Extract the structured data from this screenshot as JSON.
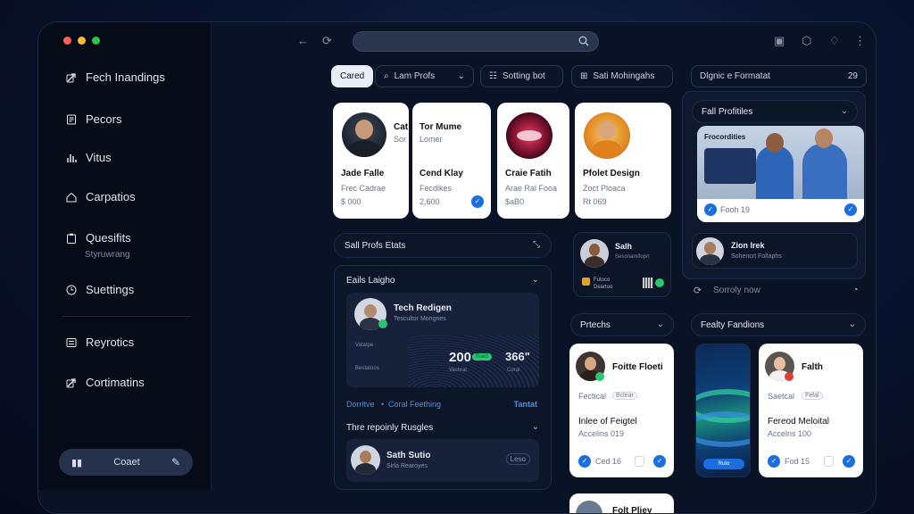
{
  "sidebar": {
    "items": [
      {
        "label": "Fech Inandings",
        "icon": "link-icon"
      },
      {
        "label": "Pecors",
        "icon": "document-icon"
      },
      {
        "label": "Vitus",
        "icon": "bars-icon"
      },
      {
        "label": "Carpatios",
        "icon": "home-icon"
      },
      {
        "label": "Quesifits",
        "icon": "clipboard-icon",
        "sub": "Styruwrang"
      },
      {
        "label": "Suettings",
        "icon": "clock-icon"
      },
      {
        "label": "Reyrotics",
        "icon": "list-icon"
      },
      {
        "label": "Cortimatins",
        "icon": "link-icon"
      }
    ],
    "bottom_button": "Coaet"
  },
  "filters": {
    "cancel": "Cared",
    "lam_profs": "Lam Profs",
    "sorting": "Sotting bot",
    "mohingahs": "Sati Mohingahs",
    "right_pill": "Dlgnic e Formatat",
    "right_count": "29"
  },
  "profile_cards": [
    {
      "name": "Jade Falle",
      "sub": "Frec Cadrae",
      "meta": "$ 000",
      "side_name": "Cat",
      "side_sub": "Sor"
    },
    {
      "name": "Cend Klay",
      "sub": "Fecdikes",
      "meta": "2,600",
      "top_name": "Tor Mume",
      "top_sub": "Lomer"
    },
    {
      "name": "Craie Fatih",
      "sub": "Arae Ral Fooa",
      "meta": "$aB0"
    },
    {
      "name": "Pfolet Design",
      "sub": "Zoct Ploaca",
      "meta": "Rt 069"
    }
  ],
  "sall_profs": "Sall Profs Etats",
  "left_panel": {
    "title": "Eails Laigho",
    "profile_name": "Tech Redigen",
    "profile_sub": "Tescultor Mongnes",
    "stat1_label": "Vatatpe",
    "stat1": "200",
    "stat1_badge": "Bsed",
    "stat1_sub": "Vasteat",
    "stat2_label": "Bestatoos",
    "stat2": "366\"",
    "stat2_sub": "Coral",
    "links_left": "Dorritve",
    "links_mid": "Coral Feething",
    "links_right": "Tantat",
    "section2": "Thre repoinly Rusgles",
    "row_name": "Sath Sutio",
    "row_sub": "Sirla Rearoyes",
    "row_tag": "Leso"
  },
  "mid_col": {
    "mini_name": "Salh",
    "mini_sub": "Sesonamlfoprt",
    "mini_tag1": "Futoco",
    "mini_tag2": "Deartoo",
    "prices": "Prtechs",
    "card_name": "Foitte Floeti",
    "card_tag1": "Fectical",
    "card_tag2": "Bclear",
    "card_line1": "Inlee of Feigtel",
    "card_line2": "Accelins 019",
    "card_ctrl": "Ced 16",
    "bottom_peek": "Folt Pliey"
  },
  "right_col": {
    "fall_profiles": "Fall Profitiles",
    "photo_caption": "Fooh 19",
    "photo_label": "Frocordities",
    "row_name": "Zion Irek",
    "row_sub": "Sohencrt Folfaphs",
    "row_meta": "Sorroly now",
    "section": "Fealty Fandions",
    "card_name": "Falth",
    "card_tag1": "Saetcal",
    "card_tag2": "Fefal",
    "card_line1": "Fereod Meloital",
    "card_line2": "Accelns 100",
    "card_ctrl": "Fod 15",
    "green_btn": "Ruto"
  },
  "colors": {
    "accent": "#1a6ee0",
    "green": "#28c76f",
    "dot_red": "#ff5f57",
    "dot_yellow": "#febc2e",
    "dot_green": "#28c840"
  }
}
